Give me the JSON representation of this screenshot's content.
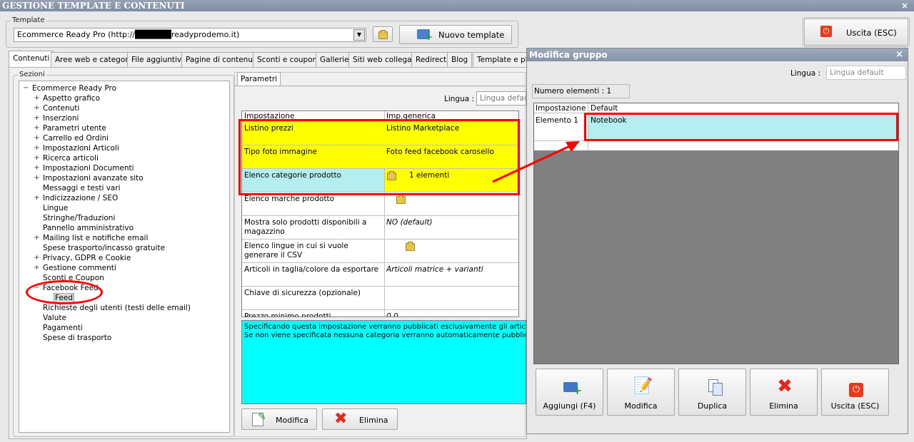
{
  "window": {
    "title": "GESTIONE TEMPLATE E CONTENUTI",
    "close": "×"
  },
  "template": {
    "legend": "Template",
    "selected": "Ecommerce Ready Pro (http://██████readyprodemo.it)",
    "new_button": "Nuovo template"
  },
  "exit_button": "Uscita (ESC)",
  "tabs": [
    "Contenuti",
    "Aree web e categorie",
    "File aggiuntivi",
    "Pagine di contenuti",
    "Sconti e coupon",
    "Gallerie",
    "Siti web collegati",
    "Redirect",
    "Blog",
    "Template e plug"
  ],
  "sections": {
    "legend": "Sezioni",
    "root": "Ecommerce Ready Pro",
    "items": [
      {
        "label": "Aspetto grafico",
        "expandable": true
      },
      {
        "label": "Contenuti",
        "expandable": true
      },
      {
        "label": "Inserzioni",
        "expandable": true
      },
      {
        "label": "Parametri utente",
        "expandable": true
      },
      {
        "label": "Carrello ed Ordini",
        "expandable": true
      },
      {
        "label": "Impostazioni Articoli",
        "expandable": true
      },
      {
        "label": "Ricerca articoli",
        "expandable": true
      },
      {
        "label": "Impostazioni Documenti",
        "expandable": true
      },
      {
        "label": "Impostazioni avanzate sito",
        "expandable": true
      },
      {
        "label": "Messaggi e testi vari",
        "expandable": false
      },
      {
        "label": "Indicizzazione / SEO",
        "expandable": true
      },
      {
        "label": "Lingue",
        "expandable": false
      },
      {
        "label": "Stringhe/Traduzioni",
        "expandable": false
      },
      {
        "label": "Pannello amministrativo",
        "expandable": false
      },
      {
        "label": "Mailing list e notifiche email",
        "expandable": true
      },
      {
        "label": "Spese trasporto/incasso gratuite",
        "expandable": false
      },
      {
        "label": "Privacy, GDPR e Cookie",
        "expandable": true
      },
      {
        "label": "Gestione commenti",
        "expandable": true
      },
      {
        "label": "Sconti e Coupon",
        "expandable": false
      },
      {
        "label": "Facebook Feed",
        "expandable": true,
        "expanded": true
      },
      {
        "label": "Feed",
        "expandable": false,
        "child": true,
        "selected": true
      },
      {
        "label": "Richieste degli utenti (testi delle email)",
        "expandable": false
      },
      {
        "label": "Valute",
        "expandable": false
      },
      {
        "label": "Pagamenti",
        "expandable": false
      },
      {
        "label": "Spese di trasporto",
        "expandable": false
      }
    ]
  },
  "params": {
    "tab": "Parametri",
    "language_label": "Lingua :",
    "language_value": "Lingua default",
    "header": [
      "Impostazione",
      "Imp.generica"
    ],
    "rows": [
      {
        "name": "Listino prezzi",
        "value": "Listino Marketplace"
      },
      {
        "name": "Tipo foto immagine",
        "value": "Foto feed facebook carosello"
      },
      {
        "name": "Elenco categorie prodotto",
        "value": "1 elementi"
      },
      {
        "name": "Elenco marche prodotto",
        "value": ""
      },
      {
        "name": "Mostra solo prodotti disponibili a magazzino",
        "value": "NO (default)"
      },
      {
        "name": "Elenco lingue in cui si vuole generare il CSV",
        "value": ""
      },
      {
        "name": "Articoli in taglia/colore da esportare",
        "value": "Articoli matrice + varianti"
      },
      {
        "name": "Chiave di sicurezza (opzionale)",
        "value": ""
      },
      {
        "name": "Prezzo minimo prodotti",
        "value": "0,0"
      }
    ],
    "description_line1": "Specificando questa impostazione verranno pubblicati esclusivamente gli articoli apparten",
    "description_line2": "Se non viene specificata nessuna categoria verranno automaticamente pubblicati tutti gli",
    "edit_button": "Modifica",
    "delete_button": "Elimina"
  },
  "dialog": {
    "title": "Modifica gruppo",
    "close": "×",
    "language_label": "Lingua :",
    "language_value": "Lingua default",
    "count": "Numero elementi : 1",
    "header": [
      "Impostazione",
      "Default"
    ],
    "row_name": "Elemento 1",
    "row_value": "Notebook",
    "buttons": [
      "Aggiungi (F4)",
      "Modifica",
      "Duplica",
      "Elimina",
      "Uscita (ESC)"
    ]
  },
  "colors": {
    "highlight_red": "#ff0000",
    "row_yellow": "#ffff00",
    "row_cyan": "#b4eef0",
    "description_bg": "#00ffff",
    "dialog_grid_bg": "#808080"
  }
}
